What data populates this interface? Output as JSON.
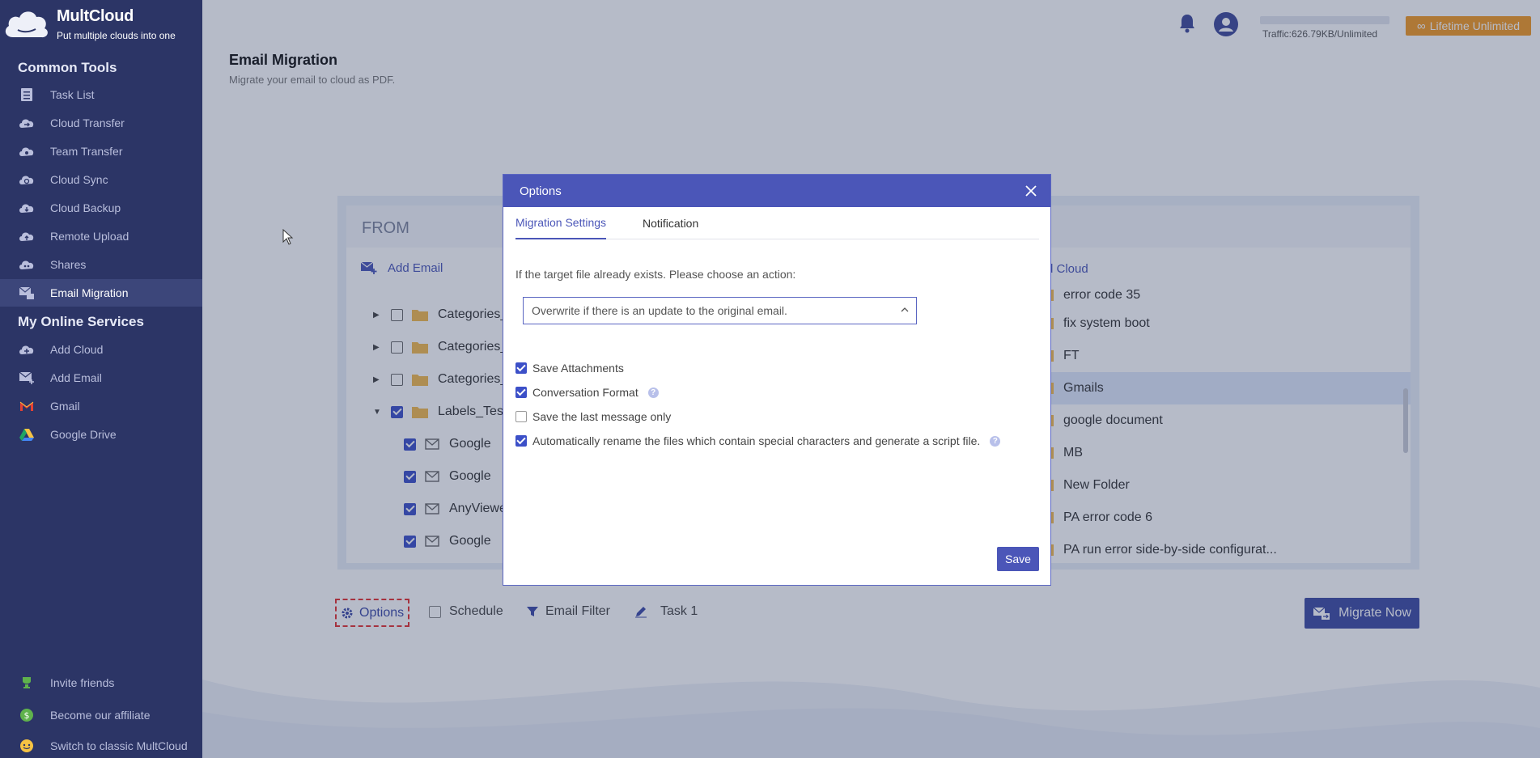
{
  "brand": {
    "name": "MultCloud",
    "tagline": "Put multiple clouds into one"
  },
  "sidebar": {
    "common_tools_title": "Common Tools",
    "common_tools": [
      {
        "label": "Task List",
        "icon": "task-list-icon"
      },
      {
        "label": "Cloud Transfer",
        "icon": "cloud-transfer-icon"
      },
      {
        "label": "Team Transfer",
        "icon": "team-transfer-icon"
      },
      {
        "label": "Cloud Sync",
        "icon": "cloud-sync-icon"
      },
      {
        "label": "Cloud Backup",
        "icon": "cloud-backup-icon"
      },
      {
        "label": "Remote Upload",
        "icon": "remote-upload-icon"
      },
      {
        "label": "Shares",
        "icon": "shares-icon"
      },
      {
        "label": "Email Migration",
        "icon": "email-migration-icon",
        "active": true
      }
    ],
    "online_services_title": "My Online Services",
    "online_services": [
      {
        "label": "Add Cloud",
        "icon": "add-cloud-icon"
      },
      {
        "label": "Add Email",
        "icon": "add-email-icon"
      },
      {
        "label": "Gmail",
        "icon": "gmail-icon"
      },
      {
        "label": "Google Drive",
        "icon": "google-drive-icon"
      }
    ],
    "footer": [
      {
        "label": "Invite friends",
        "icon": "trophy-icon"
      },
      {
        "label": "Become our affiliate",
        "icon": "dollar-icon"
      },
      {
        "label": "Switch to classic MultCloud",
        "icon": "classic-icon"
      }
    ]
  },
  "topbar": {
    "traffic": "Traffic:626.79KB/Unlimited",
    "plan_button": "Lifetime Unlimited"
  },
  "page": {
    "title": "Email Migration",
    "subtitle": "Migrate your email to cloud as PDF."
  },
  "from_panel": {
    "header": "FROM",
    "add_email": "Add Email",
    "tree": [
      {
        "label": "Categories_",
        "type": "folder",
        "expandable": true,
        "checked": false
      },
      {
        "label": "Categories_",
        "type": "folder",
        "expandable": true,
        "checked": false
      },
      {
        "label": "Categories_",
        "type": "folder",
        "expandable": true,
        "checked": false
      },
      {
        "label": "Labels_Test",
        "type": "folder",
        "expanded": true,
        "checked": true
      },
      {
        "label": "Google",
        "type": "mail",
        "checked": true
      },
      {
        "label": "Google",
        "type": "mail",
        "checked": true
      },
      {
        "label": "AnyViewe",
        "type": "mail",
        "checked": true
      },
      {
        "label": "Google",
        "type": "mail",
        "checked": true
      }
    ]
  },
  "to_panel": {
    "add_cloud": "d Cloud",
    "items": [
      {
        "label": "error code 35"
      },
      {
        "label": "fix system boot"
      },
      {
        "label": "FT"
      },
      {
        "label": "Gmails",
        "selected": true
      },
      {
        "label": "google document"
      },
      {
        "label": "MB"
      },
      {
        "label": "New Folder"
      },
      {
        "label": "PA error code 6"
      },
      {
        "label": "PA run error side-by-side configurat..."
      }
    ]
  },
  "toolbar": {
    "options": "Options",
    "schedule": "Schedule",
    "email_filter": "Email Filter",
    "task_name": "Task 1",
    "migrate_now": "Migrate Now"
  },
  "modal": {
    "title": "Options",
    "tabs": [
      "Migration Settings",
      "Notification"
    ],
    "active_tab": 0,
    "prompt": "If the target file already exists. Please choose an action:",
    "select_value": "Overwrite if there is an update to the original email.",
    "options": [
      {
        "label": "Save Attachments",
        "checked": true,
        "help": false
      },
      {
        "label": "Conversation Format",
        "checked": true,
        "help": true
      },
      {
        "label": "Save the last message only",
        "checked": false,
        "help": false
      },
      {
        "label": "Automatically rename the files which contain special characters and generate a script file.",
        "checked": true,
        "help": true
      }
    ],
    "save": "Save"
  },
  "colors": {
    "sidebar_bg": "#2c3566",
    "accent": "#4b56b8",
    "orange": "#f39a22",
    "checkbox": "#3c50c8"
  }
}
